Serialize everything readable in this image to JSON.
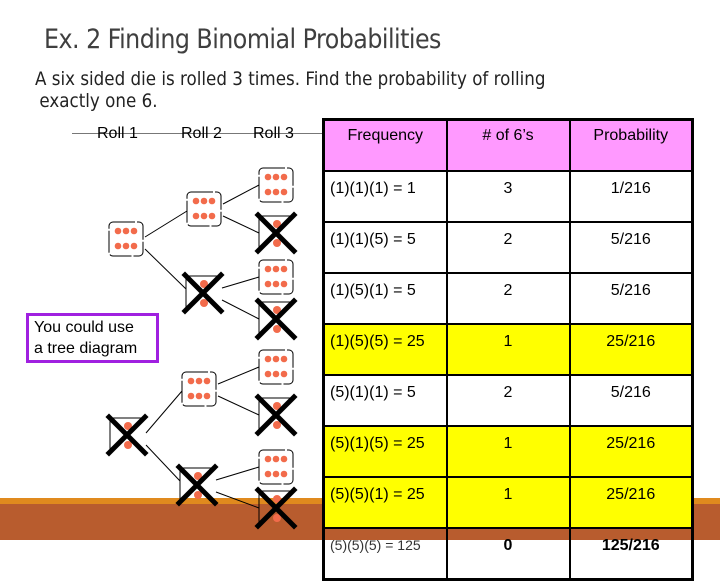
{
  "slide": {
    "title": "Ex. 2 Finding Binomial Probabilities",
    "problem_line1": "A six sided die is rolled 3 times.  Find the probability of rolling",
    "problem_line2": "exactly one 6."
  },
  "tree": {
    "roll_labels": [
      "Roll 1",
      "Roll 2",
      "Roll 3"
    ],
    "callout": {
      "line1": "You could use",
      "line2": "a tree diagram",
      "border_color": "#A020E0"
    },
    "die_icon": "six-die-icon",
    "crossed_die_icon": "crossed-out-die-icon",
    "pip_color": "#F26B4B",
    "roll1": [
      "six",
      "not-six"
    ],
    "roll2": [
      "six",
      "not-six",
      "six",
      "not-six"
    ],
    "roll3": [
      "six",
      "not-six",
      "six",
      "not-six",
      "six",
      "not-six",
      "six",
      "not-six"
    ]
  },
  "table": {
    "headers": [
      "Frequency",
      "# of 6’s",
      "Probability"
    ],
    "header_color": "#FF99FF",
    "highlight_color": "#FFFF00",
    "rows": [
      {
        "frequency": "(1)(1)(1) = 1",
        "sixes": "3",
        "probability": "1/216",
        "highlighted": false
      },
      {
        "frequency": "(1)(1)(5) = 5",
        "sixes": "2",
        "probability": "5/216",
        "highlighted": false
      },
      {
        "frequency": "(1)(5)(1) = 5",
        "sixes": "2",
        "probability": "5/216",
        "highlighted": false
      },
      {
        "frequency": "(1)(5)(5) = 25",
        "sixes": "1",
        "probability": "25/216",
        "highlighted": true
      },
      {
        "frequency": "(5)(1)(1) = 5",
        "sixes": "2",
        "probability": "5/216",
        "highlighted": false
      },
      {
        "frequency": "(5)(1)(5) = 25",
        "sixes": "1",
        "probability": "25/216",
        "highlighted": true
      },
      {
        "frequency": "(5)(5)(1) = 25",
        "sixes": "1",
        "probability": "25/216",
        "highlighted": true
      },
      {
        "frequency": "(5)(5)(5) = 125",
        "sixes": "0",
        "probability": "125/216",
        "highlighted": false
      }
    ]
  },
  "theme": {
    "footer_orange": "#E08A1E",
    "footer_rust": "#B85C2E"
  }
}
